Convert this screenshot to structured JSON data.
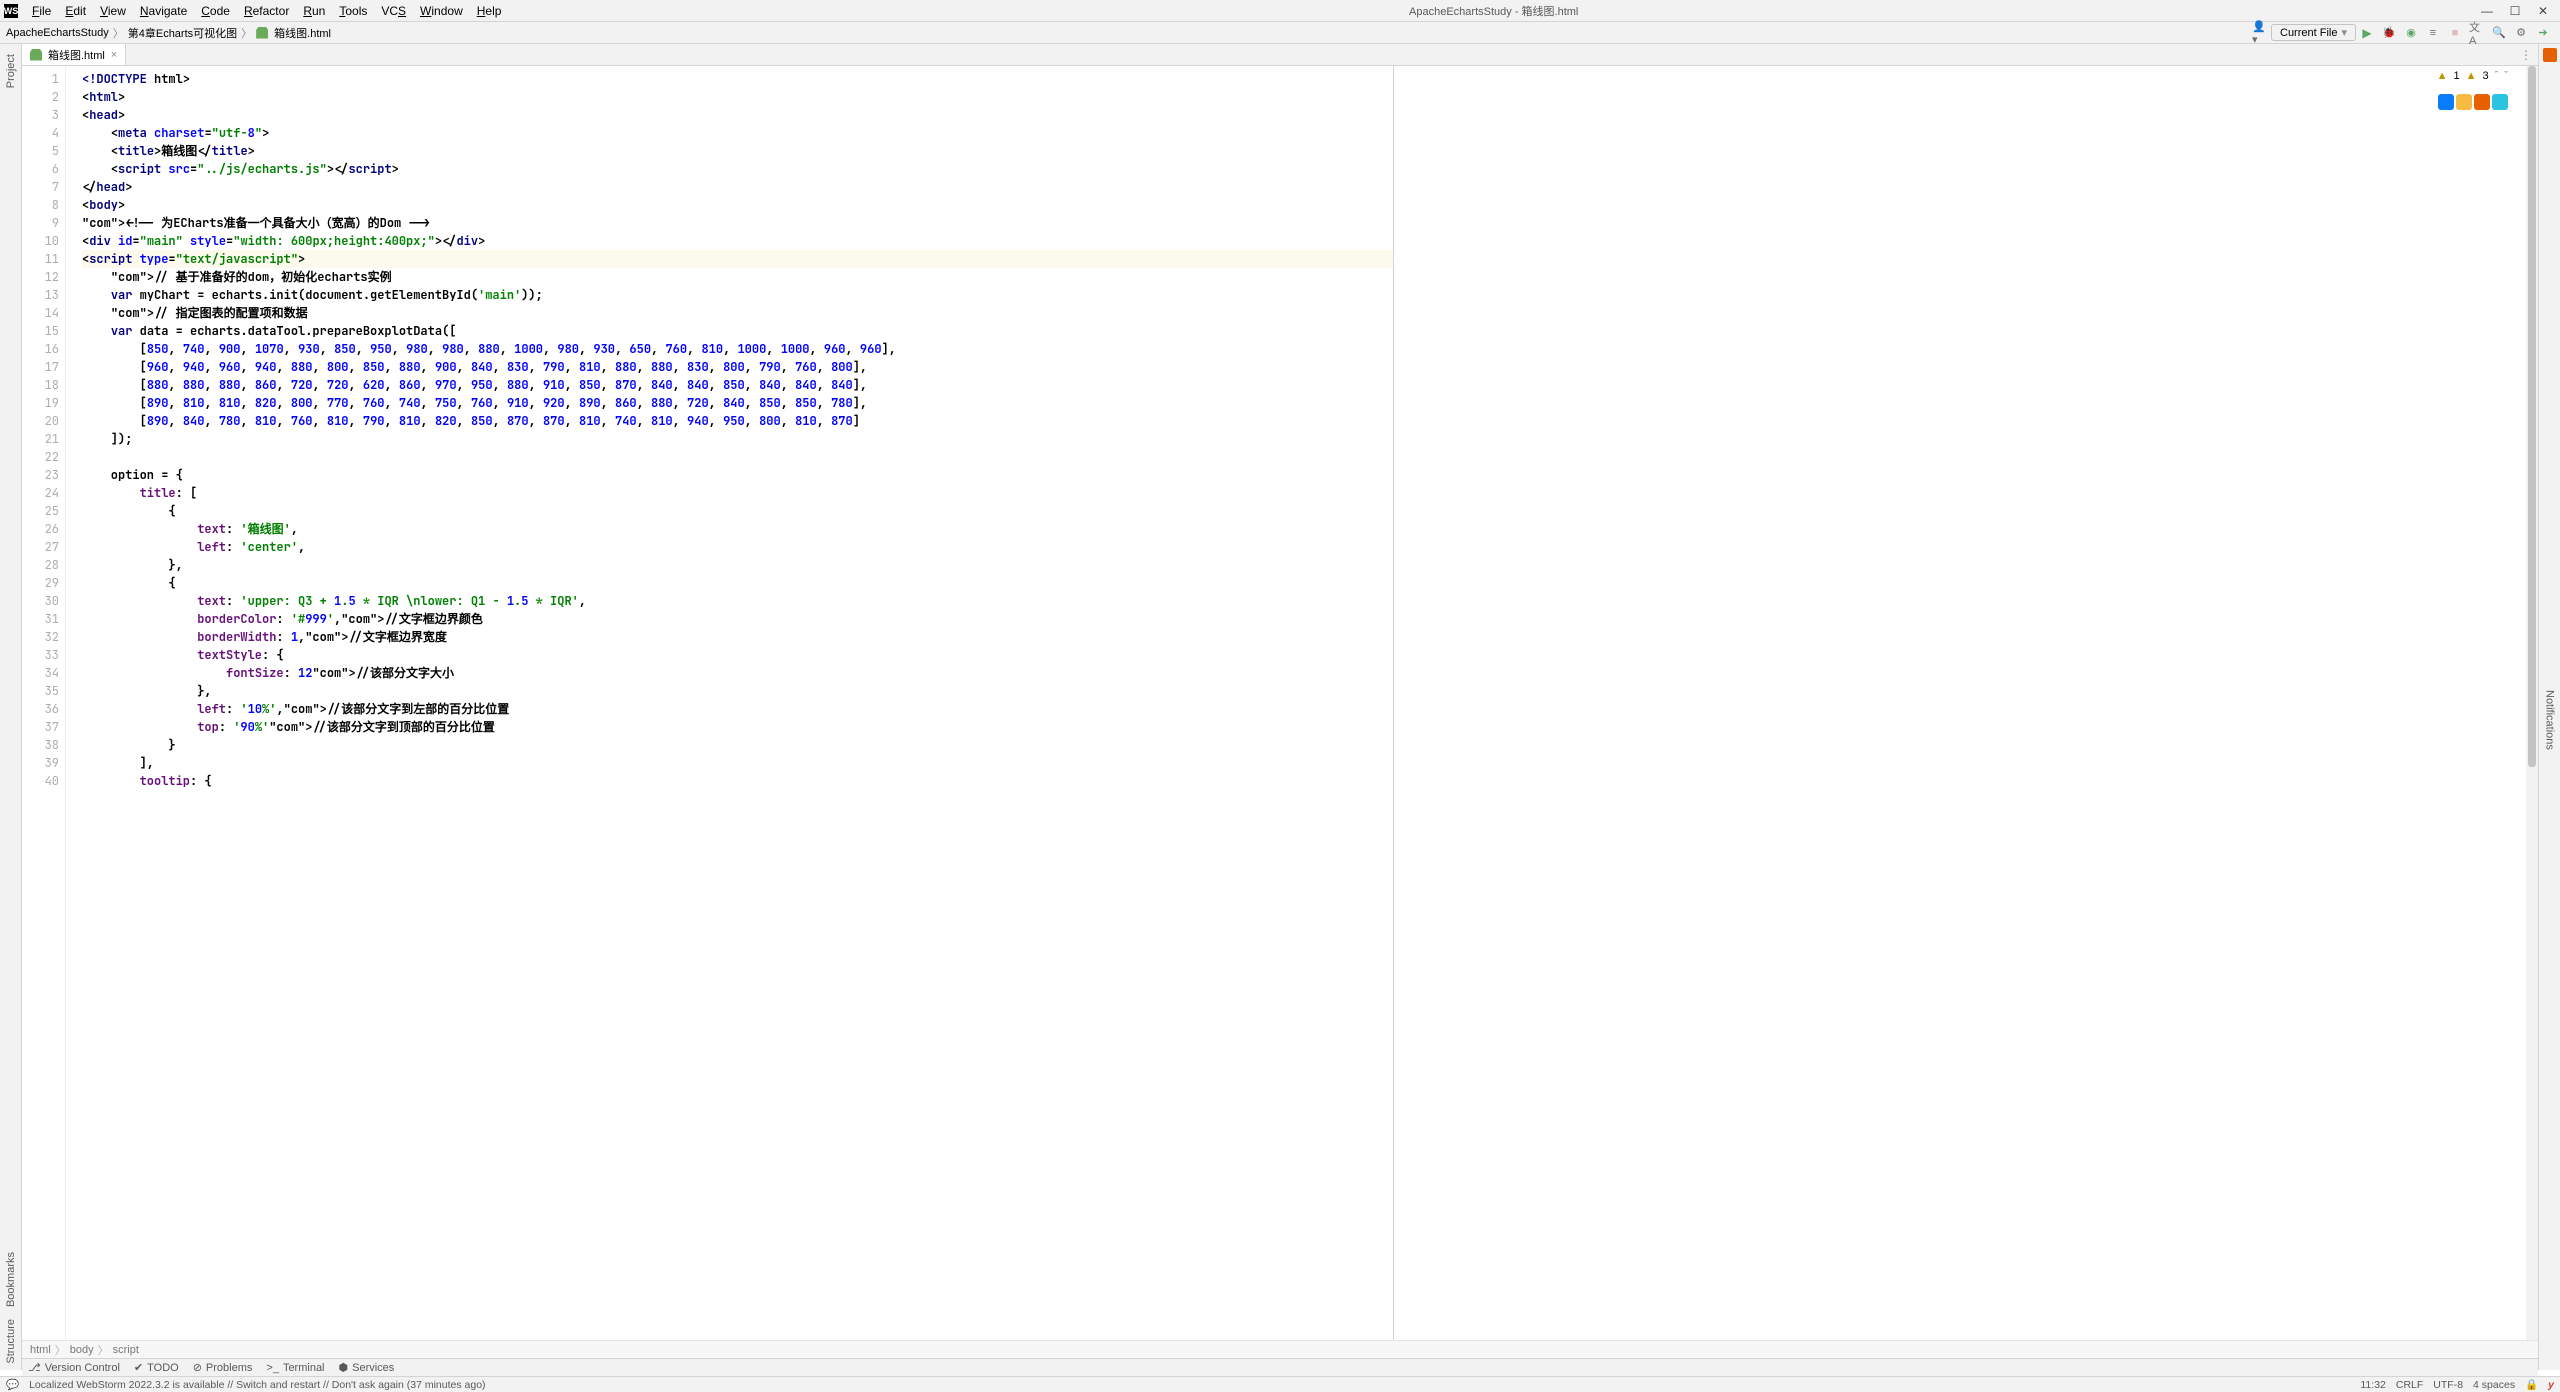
{
  "app_icon": "WS",
  "menu": [
    "File",
    "Edit",
    "View",
    "Navigate",
    "Code",
    "Refactor",
    "Run",
    "Tools",
    "VCS",
    "Window",
    "Help"
  ],
  "menu_underline_idx": [
    0,
    0,
    0,
    0,
    0,
    0,
    0,
    0,
    2,
    0,
    0
  ],
  "title": "ApacheEchartsStudy - 箱线图.html",
  "crumbs": [
    "ApacheEchartsStudy",
    "第4章Echarts可视化图",
    "箱线图.html"
  ],
  "run_config": "Current File",
  "tabs": [
    {
      "name": "箱线图.html"
    }
  ],
  "left_tabs": [
    "Project",
    "Bookmarks",
    "Structure"
  ],
  "right_tabs": [
    "Notifications"
  ],
  "inspections": {
    "warnings": "1",
    "weak": "3"
  },
  "breadcrumbs": [
    "html",
    "body",
    "script"
  ],
  "bottom_tools": [
    "Version Control",
    "TODO",
    "Problems",
    "Terminal",
    "Services"
  ],
  "status_left": "Localized WebStorm 2022.3.2 is available // Switch and restart // Don't ask again (37 minutes ago)",
  "status_right": {
    "caret": "11:32",
    "le": "CRLF",
    "enc": "UTF-8",
    "indent": "4 spaces"
  },
  "code_lines": [
    "<!DOCTYPE html>",
    "<html>",
    "<head>",
    "    <meta charset=\"utf-8\">",
    "    <title>箱线图</title>",
    "    <script src=\"../js/echarts.js\"></__script>",
    "</head>",
    "<body>",
    "<!-- 为ECharts准备一个具备大小（宽高）的Dom -->",
    "<div id=\"main\" style=\"width: 600px;height:400px;\"></div>",
    "<script type=\"text/javascript\">",
    "    // 基于准备好的dom，初始化echarts实例",
    "    var myChart = echarts.init(document.getElementById('main'));",
    "    // 指定图表的配置项和数据",
    "    var data = echarts.dataTool.prepareBoxplotData([",
    "        [850, 740, 900, 1070, 930, 850, 950, 980, 980, 880, 1000, 980, 930, 650, 760, 810, 1000, 1000, 960, 960],",
    "        [960, 940, 960, 940, 880, 800, 850, 880, 900, 840, 830, 790, 810, 880, 880, 830, 800, 790, 760, 800],",
    "        [880, 880, 880, 860, 720, 720, 620, 860, 970, 950, 880, 910, 850, 870, 840, 840, 850, 840, 840, 840],",
    "        [890, 810, 810, 820, 800, 770, 760, 740, 750, 760, 910, 920, 890, 860, 880, 720, 840, 850, 850, 780],",
    "        [890, 840, 780, 810, 760, 810, 790, 810, 820, 850, 870, 870, 810, 740, 810, 940, 950, 800, 810, 870]",
    "    ]);",
    "",
    "    option = {",
    "        title: [",
    "            {",
    "                text: '箱线图',",
    "                left: 'center',",
    "            },",
    "            {",
    "                text: 'upper: Q3 + 1.5 * IQR \\nlower: Q1 - 1.5 * IQR',",
    "                borderColor: '#999',//文字框边界颜色",
    "                borderWidth: 1,//文字框边界宽度",
    "                textStyle: {",
    "                    fontSize: 12//该部分文字大小",
    "                },",
    "                left: '10%',//该部分文字到左部的百分比位置",
    "                top: '90%'//该部分文字到顶部的百分比位置",
    "            }",
    "        ],",
    "        tooltip: {"
  ],
  "current_line": 11,
  "gutter_marker_line": 31
}
